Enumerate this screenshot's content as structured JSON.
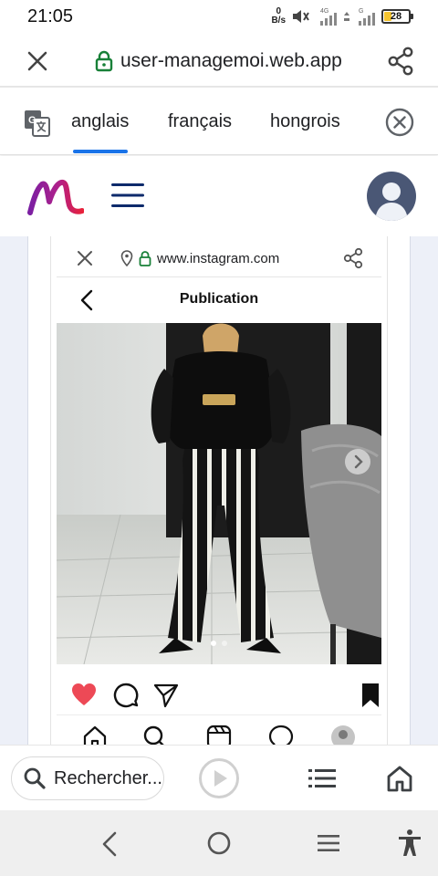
{
  "status_bar": {
    "time": "21:05",
    "net_speed_value": "0",
    "net_speed_unit": "B/s",
    "signal_1_label": "4G",
    "signal_2_label": "G",
    "battery_level": "28"
  },
  "browser": {
    "url": "user-managemoi.web.app"
  },
  "translate_bar": {
    "languages": [
      "anglais",
      "français",
      "hongrois"
    ],
    "selected_index": 0,
    "accent_color": "#1a73e8"
  },
  "site": {
    "logo_colors": [
      "#8a1fb0",
      "#e2203b"
    ],
    "menu_color": "#0d2a6b",
    "avatar_color": "#4a5775"
  },
  "embedded_page": {
    "url": "www.instagram.com",
    "title": "Publication",
    "carousel_dots": 2,
    "active_dot": 0,
    "like_color": "#ed4956"
  },
  "bottom_toolbar": {
    "search_label": "Rechercher..."
  },
  "icons": {
    "url_bar": [
      "close-icon",
      "lock-icon",
      "share-icon"
    ],
    "translate_bar": [
      "google-translate-icon",
      "close-circle-icon"
    ],
    "post_actions": [
      "heart-icon",
      "comment-icon",
      "send-icon",
      "bookmark-icon"
    ],
    "ig_nav": [
      "home-icon",
      "search-icon",
      "reels-icon",
      "messenger-icon",
      "profile-icon"
    ],
    "system_nav": [
      "back-icon",
      "home-circle-icon",
      "recents-icon",
      "accessibility-icon"
    ]
  }
}
